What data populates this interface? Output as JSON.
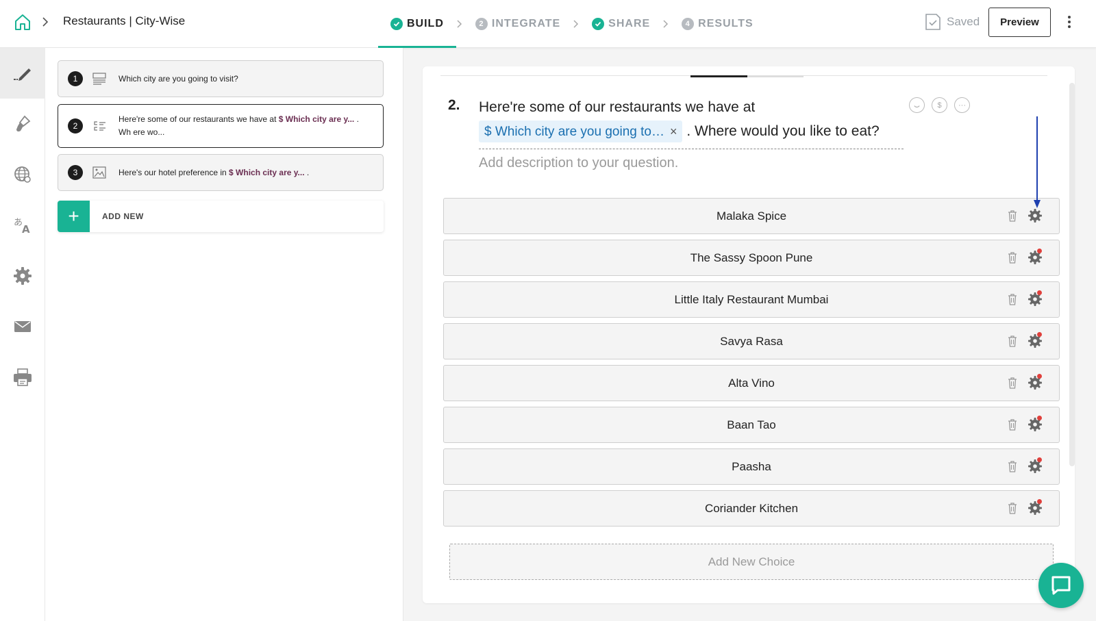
{
  "header": {
    "survey_title": "Restaurants | City-Wise",
    "steps": [
      {
        "label": "BUILD",
        "status": "done",
        "active": true
      },
      {
        "label": "INTEGRATE",
        "status": "pending",
        "number": "2"
      },
      {
        "label": "SHARE",
        "status": "done"
      },
      {
        "label": "RESULTS",
        "status": "pending",
        "number": "4"
      }
    ],
    "saved_label": "Saved",
    "preview_label": "Preview"
  },
  "rail": {
    "items": [
      "edit-icon",
      "paint-brush-icon",
      "globe-icon",
      "translate-icon",
      "gear-icon",
      "mail-icon",
      "printer-icon"
    ]
  },
  "questions": [
    {
      "number": "1",
      "text": "Which city are you going to visit?",
      "icon": "text-icon"
    },
    {
      "number": "2",
      "text_before": "Here're some of our restaurants we have at ",
      "pipe": "$ Which city are y...",
      "text_after": " . Wh ere wo...",
      "icon": "choice-list-icon"
    },
    {
      "number": "3",
      "text_before": "Here's our hotel preference in ",
      "pipe": "$ Which city are y...",
      "text_after": " .",
      "icon": "image-icon"
    }
  ],
  "add_new_label": "ADD NEW",
  "editor": {
    "question_number": "2.",
    "title_before": "Here're some of our restaurants we have at",
    "pipe_chip": "$ Which city are you going to…",
    "pipe_close": "×",
    "title_after": ". Where would you like to eat?",
    "description_placeholder": "Add description to your question.",
    "tool_dollar": "$",
    "tool_more": "···",
    "progress_fraction": 0.5,
    "choices": [
      "Malaka Spice",
      "The Sassy Spoon Pune",
      "Little Italy Restaurant Mumbai",
      "Savya Rasa",
      "Alta Vino",
      "Baan Tao",
      "Paasha",
      "Coriander Kitchen"
    ],
    "choice_settings_alert": [
      false,
      true,
      true,
      true,
      true,
      true,
      true,
      true
    ],
    "add_choice_label": "Add New Choice"
  },
  "colors": {
    "accent": "#19b394",
    "pipe_text": "#6b2f52",
    "annotation_arrow": "#1e40af"
  }
}
